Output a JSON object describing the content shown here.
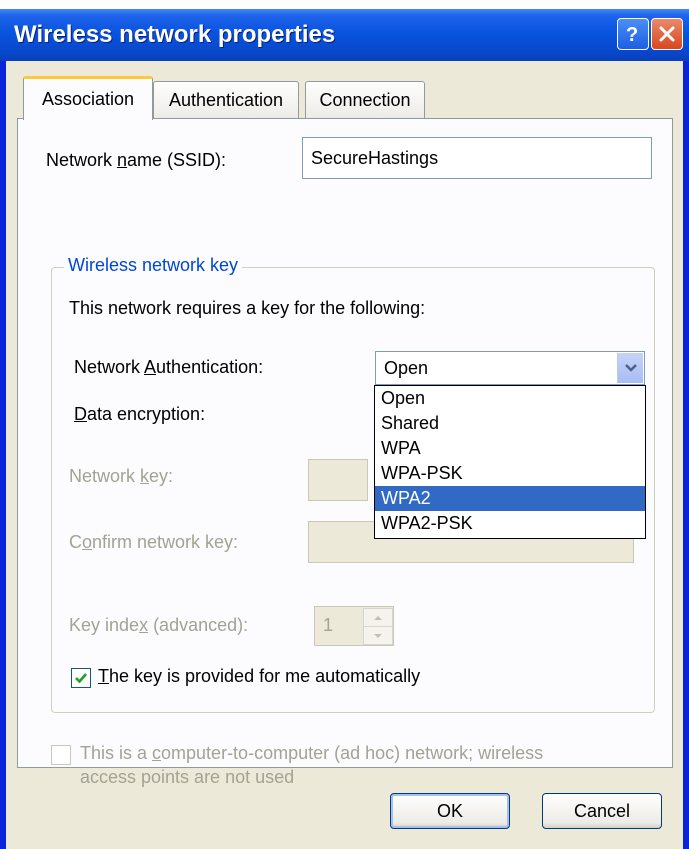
{
  "window": {
    "title": "Wireless network properties"
  },
  "tabs": [
    {
      "label": "Association",
      "active": true
    },
    {
      "label": "Authentication",
      "active": false
    },
    {
      "label": "Connection",
      "active": false
    }
  ],
  "association": {
    "ssid_label_pre": "Network ",
    "ssid_label_ul": "n",
    "ssid_label_post": "ame (SSID):",
    "ssid_value": "SecureHastings",
    "group_title": "Wireless network key",
    "requires_text": "This network requires a key for the following:",
    "auth_label_pre": "Network ",
    "auth_label_ul": "A",
    "auth_label_post": "uthentication:",
    "auth_selected": "Open",
    "auth_options": [
      "Open",
      "Shared",
      "WPA",
      "WPA-PSK",
      "WPA2",
      "WPA2-PSK"
    ],
    "auth_highlighted": "WPA2",
    "enc_label_ul": "D",
    "enc_label_post": "ata encryption:",
    "key_label_pre": "Network ",
    "key_label_ul": "k",
    "key_label_post": "ey:",
    "confirm_label_pre": "C",
    "confirm_label_ul": "o",
    "confirm_label_post": "nfirm network key:",
    "index_label_pre": "Key inde",
    "index_label_ul": "x",
    "index_label_post": " (advanced):",
    "index_value": "1",
    "auto_key_ul": "T",
    "auto_key_post": "he key is provided for me automatically",
    "auto_key_checked": true,
    "adhoc_line1_pre": "This is a ",
    "adhoc_line1_ul": "c",
    "adhoc_line1_post": "omputer-to-computer (ad hoc) network; wireless",
    "adhoc_line2": "access points are not used",
    "adhoc_checked": false
  },
  "buttons": {
    "ok": "OK",
    "cancel": "Cancel"
  },
  "colors": {
    "title_bar": "#0954e0",
    "group_title": "#0046d5",
    "highlight": "#316ac5",
    "tab_accent": "#ffc83c"
  }
}
